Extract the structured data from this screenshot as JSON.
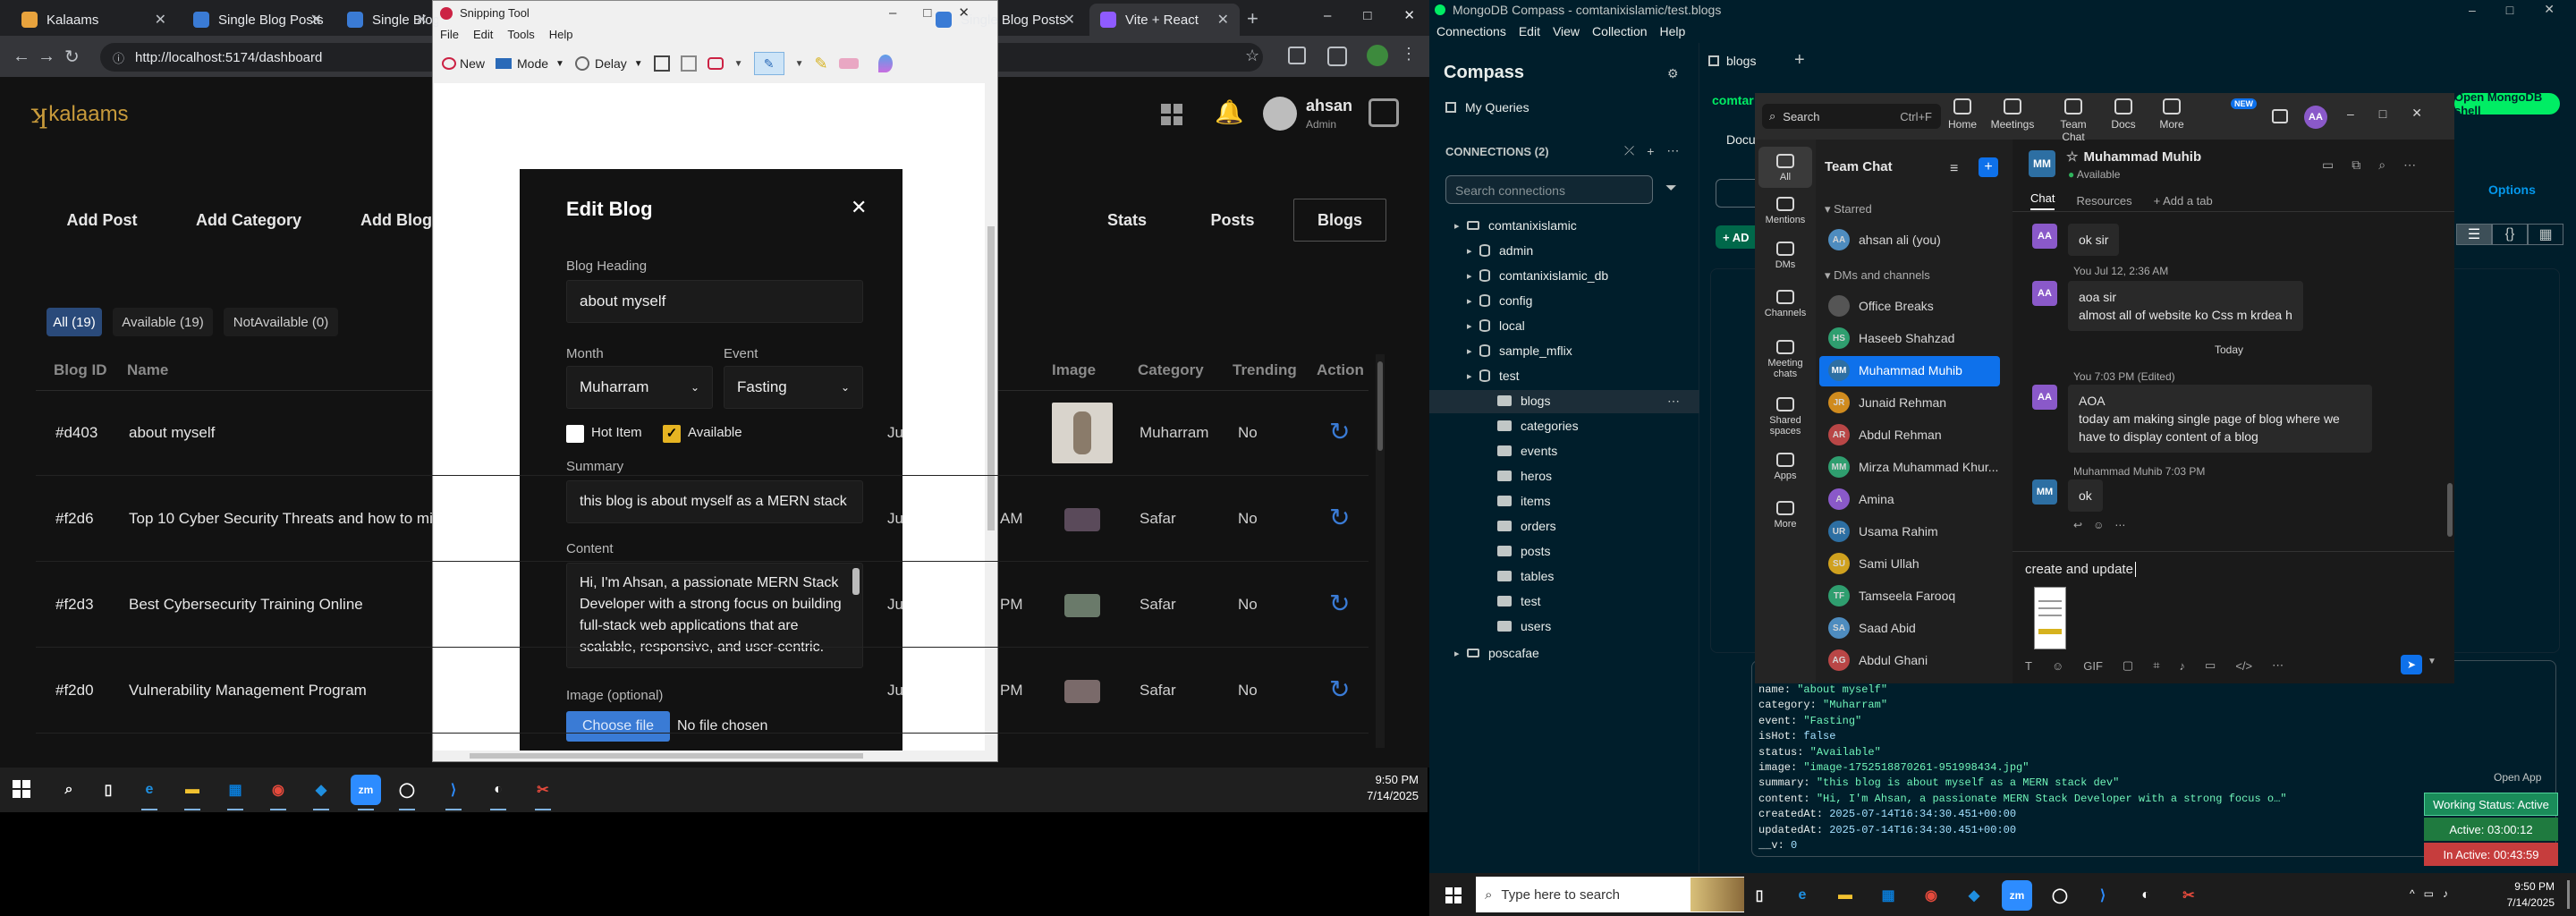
{
  "chrome": {
    "tabs": [
      {
        "label": "Kalaams",
        "color": "#e8a33d"
      },
      {
        "label": "Single Blog Posts",
        "color": "#3a7bd5"
      },
      {
        "label": "Single Blog Po",
        "color": "#3a7bd5"
      },
      {
        "label": "Single Blog Posts",
        "color": "#3a7bd5"
      },
      {
        "label": "Vite + React",
        "color": "#8f5bff"
      }
    ],
    "url": "http://localhost:5174/dashboard",
    "window_controls": [
      "–",
      "□",
      "✕"
    ]
  },
  "app": {
    "brand": "kalaams",
    "user_name": "ahsan",
    "user_role": "Admin",
    "tabs_left": [
      "Add Post",
      "Add Category",
      "Add Blog"
    ],
    "tabs_right": [
      "Stats",
      "Posts",
      "Blogs"
    ],
    "filters": [
      "All (19)",
      "Available (19)",
      "NotAvailable (0)"
    ],
    "columns": [
      "Blog ID",
      "Name",
      "Image",
      "Category",
      "Trending",
      "Action"
    ],
    "rows": [
      {
        "id": "#d403",
        "name": "about myself",
        "cut": "",
        "category": "Muharram",
        "trending": "No"
      },
      {
        "id": "#f2d6",
        "name": "Top 10 Cyber Security Threats and how to mi",
        "cut": "AM",
        "category": "Safar",
        "trending": "No"
      },
      {
        "id": "#f2d3",
        "name": "Best Cybersecurity Training Online",
        "cut": "PM",
        "category": "Safar",
        "trending": "No"
      },
      {
        "id": "#f2d0",
        "name": "Vulnerability Management Program",
        "cut": "PM",
        "category": "Safar",
        "trending": "No"
      }
    ],
    "cut_labels": [
      "Ju",
      "Ju",
      "Ju",
      "Ju"
    ]
  },
  "snip": {
    "title": "Snipping Tool",
    "menu": [
      "File",
      "Edit",
      "Tools",
      "Help"
    ],
    "toolbar": {
      "new": "New",
      "mode": "Mode",
      "delay": "Delay"
    },
    "modal": {
      "title": "Edit Blog",
      "heading_label": "Blog Heading",
      "heading_value": "about myself",
      "month_label": "Month",
      "month_value": "Muharram",
      "event_label": "Event",
      "event_value": "Fasting",
      "hot_label": "Hot Item",
      "available_label": "Available",
      "summary_label": "Summary",
      "summary_value": "this blog is about myself as a MERN stack",
      "content_label": "Content",
      "content_value": "Hi, I'm Ahsan, a passionate MERN Stack Developer with a strong focus on building full-stack web applications that are scalable, responsive, and user-centric.",
      "image_label": "Image (optional)",
      "choose_file": "Choose file",
      "no_file": "No file chosen"
    }
  },
  "taskbar_left": {
    "time": "9:50 PM",
    "date": "7/14/2025"
  },
  "compass": {
    "title": "MongoDB Compass - comtanixislamic/test.blogs",
    "menu": [
      "Connections",
      "Edit",
      "View",
      "Collection",
      "Help"
    ],
    "brand": "Compass",
    "my_queries": "My Queries",
    "connections_label": "CONNECTIONS (2)",
    "search_placeholder": "Search connections",
    "tab": "blogs",
    "tree": [
      {
        "label": "comtanixislamic",
        "depth": 0
      },
      {
        "label": "admin",
        "depth": 1
      },
      {
        "label": "comtanixislamic_db",
        "depth": 1
      },
      {
        "label": "config",
        "depth": 1
      },
      {
        "label": "local",
        "depth": 1
      },
      {
        "label": "sample_mflix",
        "depth": 1
      },
      {
        "label": "test",
        "depth": 1
      },
      {
        "label": "blogs",
        "depth": 2
      },
      {
        "label": "categories",
        "depth": 2
      },
      {
        "label": "events",
        "depth": 2
      },
      {
        "label": "heros",
        "depth": 2
      },
      {
        "label": "items",
        "depth": 2
      },
      {
        "label": "orders",
        "depth": 2
      },
      {
        "label": "posts",
        "depth": 2
      },
      {
        "label": "tables",
        "depth": 2
      },
      {
        "label": "test",
        "depth": 2
      },
      {
        "label": "users",
        "depth": 2
      },
      {
        "label": "poscafae",
        "depth": 0
      }
    ],
    "open_shell": "Open MongoDB shell",
    "options": "Options",
    "doc_label": "Docu",
    "conn_partial": "comtar",
    "document": [
      {
        "k": "name",
        "v": "\"about myself\"",
        "t": "s"
      },
      {
        "k": "category",
        "v": "\"Muharram\"",
        "t": "s"
      },
      {
        "k": "event",
        "v": "\"Fasting\"",
        "t": "s"
      },
      {
        "k": "isHot",
        "v": "false",
        "t": "n"
      },
      {
        "k": "status",
        "v": "\"Available\"",
        "t": "s"
      },
      {
        "k": "image",
        "v": "\"image-1752518870261-951998434.jpg\"",
        "t": "s"
      },
      {
        "k": "summary",
        "v": "\"this blog is about myself as a MERN stack dev\"",
        "t": "s"
      },
      {
        "k": "content",
        "v": "\"Hi, I'm Ahsan, a passionate MERN Stack Developer with a strong focus o…\"",
        "t": "s"
      },
      {
        "k": "createdAt",
        "v": "2025-07-14T16:34:30.451+00:00",
        "t": "n"
      },
      {
        "k": "updatedAt",
        "v": "2025-07-14T16:34:30.451+00:00",
        "t": "n"
      },
      {
        "k": "__v",
        "v": "0",
        "t": "n"
      }
    ]
  },
  "teams": {
    "search": "Search",
    "shortcut": "Ctrl+F",
    "nav": [
      "Home",
      "Meetings",
      "Team Chat",
      "Docs",
      "More"
    ],
    "new_badge": "NEW",
    "user_initials": "AA",
    "rail": [
      "All",
      "Mentions",
      "DMs",
      "Channels",
      "Meeting chats",
      "Shared spaces",
      "Apps",
      "More"
    ],
    "list_title": "Team Chat",
    "starred": "Starred",
    "dms_label": "DMs and channels",
    "people": [
      {
        "name": "ahsan ali (you)",
        "init": "AA",
        "color": "#4e8cbf",
        "section": "starred"
      },
      {
        "name": "Office Breaks",
        "init": "",
        "color": "#555",
        "section": "dm"
      },
      {
        "name": "Haseeb Shahzad",
        "init": "HS",
        "color": "#2f9e6f",
        "section": "dm"
      },
      {
        "name": "Muhammad Muhib",
        "init": "MM",
        "color": "#2d6fa3",
        "section": "dm"
      },
      {
        "name": "Junaid Rehman",
        "init": "JR",
        "color": "#d08b1e",
        "section": "dm"
      },
      {
        "name": "Abdul Rehman",
        "init": "AR",
        "color": "#b94646",
        "section": "dm"
      },
      {
        "name": "Mirza Muhammad Khur...",
        "init": "MM",
        "color": "#2f9e6f",
        "section": "dm"
      },
      {
        "name": "Amina",
        "init": "A",
        "color": "#8a59c9",
        "section": "dm"
      },
      {
        "name": "Usama Rahim",
        "init": "UR",
        "color": "#2d6fa3",
        "section": "dm"
      },
      {
        "name": "Sami Ullah",
        "init": "SU",
        "color": "#d0a11e",
        "section": "dm"
      },
      {
        "name": "Tamseela Farooq",
        "init": "TF",
        "color": "#2f9e6f",
        "section": "dm"
      },
      {
        "name": "Saad Abid",
        "init": "SA",
        "color": "#4e8cbf",
        "section": "dm"
      },
      {
        "name": "Abdul Ghani",
        "init": "AG",
        "color": "#b94646",
        "section": "dm"
      }
    ],
    "chat_name": "Muhammad Muhib",
    "chat_init": "MM",
    "chat_status": "Available",
    "chat_tabs": [
      "Chat",
      "Resources",
      "+ Add a tab"
    ],
    "messages": [
      {
        "meta": "",
        "text": "ok sir"
      },
      {
        "meta": "You  Jul 12, 2:36 AM",
        "text": "aoa sir\nalmost all of website ko Css m krdea h"
      },
      {
        "meta": "You  7:03 PM (Edited)",
        "text": "AOA\ntoday am making single page of blog where we\nhave to display content of a blog"
      },
      {
        "meta": "Muhammad Muhib  7:03 PM",
        "text": "ok"
      }
    ],
    "today": "Today",
    "compose": "create and update",
    "working": [
      "Working Status: Active",
      "Active: 03:00:12",
      "In Active: 00:43:59"
    ],
    "open_app": "Open App"
  },
  "taskbar_right": {
    "search": "Type here to search",
    "time": "9:50 PM",
    "date": "7/14/2025"
  }
}
